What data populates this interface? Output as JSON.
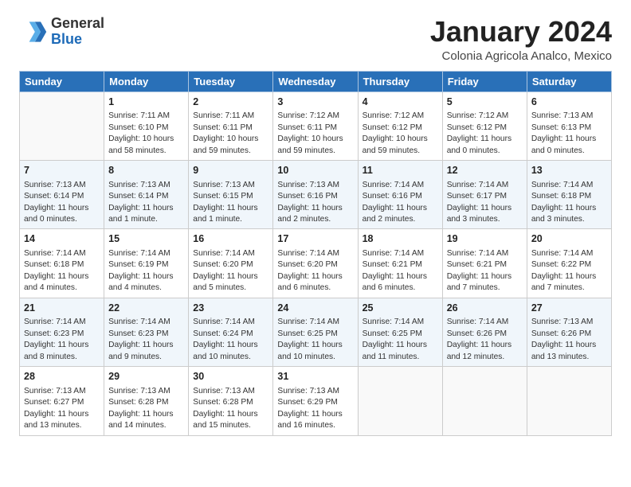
{
  "header": {
    "logo_general": "General",
    "logo_blue": "Blue",
    "month_title": "January 2024",
    "subtitle": "Colonia Agricola Analco, Mexico"
  },
  "weekdays": [
    "Sunday",
    "Monday",
    "Tuesday",
    "Wednesday",
    "Thursday",
    "Friday",
    "Saturday"
  ],
  "weeks": [
    [
      {
        "day": null,
        "info": null
      },
      {
        "day": "1",
        "info": "Sunrise: 7:11 AM\nSunset: 6:10 PM\nDaylight: 10 hours\nand 58 minutes."
      },
      {
        "day": "2",
        "info": "Sunrise: 7:11 AM\nSunset: 6:11 PM\nDaylight: 10 hours\nand 59 minutes."
      },
      {
        "day": "3",
        "info": "Sunrise: 7:12 AM\nSunset: 6:11 PM\nDaylight: 10 hours\nand 59 minutes."
      },
      {
        "day": "4",
        "info": "Sunrise: 7:12 AM\nSunset: 6:12 PM\nDaylight: 10 hours\nand 59 minutes."
      },
      {
        "day": "5",
        "info": "Sunrise: 7:12 AM\nSunset: 6:12 PM\nDaylight: 11 hours\nand 0 minutes."
      },
      {
        "day": "6",
        "info": "Sunrise: 7:13 AM\nSunset: 6:13 PM\nDaylight: 11 hours\nand 0 minutes."
      }
    ],
    [
      {
        "day": "7",
        "info": "Sunrise: 7:13 AM\nSunset: 6:14 PM\nDaylight: 11 hours\nand 0 minutes."
      },
      {
        "day": "8",
        "info": "Sunrise: 7:13 AM\nSunset: 6:14 PM\nDaylight: 11 hours\nand 1 minute."
      },
      {
        "day": "9",
        "info": "Sunrise: 7:13 AM\nSunset: 6:15 PM\nDaylight: 11 hours\nand 1 minute."
      },
      {
        "day": "10",
        "info": "Sunrise: 7:13 AM\nSunset: 6:16 PM\nDaylight: 11 hours\nand 2 minutes."
      },
      {
        "day": "11",
        "info": "Sunrise: 7:14 AM\nSunset: 6:16 PM\nDaylight: 11 hours\nand 2 minutes."
      },
      {
        "day": "12",
        "info": "Sunrise: 7:14 AM\nSunset: 6:17 PM\nDaylight: 11 hours\nand 3 minutes."
      },
      {
        "day": "13",
        "info": "Sunrise: 7:14 AM\nSunset: 6:18 PM\nDaylight: 11 hours\nand 3 minutes."
      }
    ],
    [
      {
        "day": "14",
        "info": "Sunrise: 7:14 AM\nSunset: 6:18 PM\nDaylight: 11 hours\nand 4 minutes."
      },
      {
        "day": "15",
        "info": "Sunrise: 7:14 AM\nSunset: 6:19 PM\nDaylight: 11 hours\nand 4 minutes."
      },
      {
        "day": "16",
        "info": "Sunrise: 7:14 AM\nSunset: 6:20 PM\nDaylight: 11 hours\nand 5 minutes."
      },
      {
        "day": "17",
        "info": "Sunrise: 7:14 AM\nSunset: 6:20 PM\nDaylight: 11 hours\nand 6 minutes."
      },
      {
        "day": "18",
        "info": "Sunrise: 7:14 AM\nSunset: 6:21 PM\nDaylight: 11 hours\nand 6 minutes."
      },
      {
        "day": "19",
        "info": "Sunrise: 7:14 AM\nSunset: 6:21 PM\nDaylight: 11 hours\nand 7 minutes."
      },
      {
        "day": "20",
        "info": "Sunrise: 7:14 AM\nSunset: 6:22 PM\nDaylight: 11 hours\nand 7 minutes."
      }
    ],
    [
      {
        "day": "21",
        "info": "Sunrise: 7:14 AM\nSunset: 6:23 PM\nDaylight: 11 hours\nand 8 minutes."
      },
      {
        "day": "22",
        "info": "Sunrise: 7:14 AM\nSunset: 6:23 PM\nDaylight: 11 hours\nand 9 minutes."
      },
      {
        "day": "23",
        "info": "Sunrise: 7:14 AM\nSunset: 6:24 PM\nDaylight: 11 hours\nand 10 minutes."
      },
      {
        "day": "24",
        "info": "Sunrise: 7:14 AM\nSunset: 6:25 PM\nDaylight: 11 hours\nand 10 minutes."
      },
      {
        "day": "25",
        "info": "Sunrise: 7:14 AM\nSunset: 6:25 PM\nDaylight: 11 hours\nand 11 minutes."
      },
      {
        "day": "26",
        "info": "Sunrise: 7:14 AM\nSunset: 6:26 PM\nDaylight: 11 hours\nand 12 minutes."
      },
      {
        "day": "27",
        "info": "Sunrise: 7:13 AM\nSunset: 6:26 PM\nDaylight: 11 hours\nand 13 minutes."
      }
    ],
    [
      {
        "day": "28",
        "info": "Sunrise: 7:13 AM\nSunset: 6:27 PM\nDaylight: 11 hours\nand 13 minutes."
      },
      {
        "day": "29",
        "info": "Sunrise: 7:13 AM\nSunset: 6:28 PM\nDaylight: 11 hours\nand 14 minutes."
      },
      {
        "day": "30",
        "info": "Sunrise: 7:13 AM\nSunset: 6:28 PM\nDaylight: 11 hours\nand 15 minutes."
      },
      {
        "day": "31",
        "info": "Sunrise: 7:13 AM\nSunset: 6:29 PM\nDaylight: 11 hours\nand 16 minutes."
      },
      {
        "day": null,
        "info": null
      },
      {
        "day": null,
        "info": null
      },
      {
        "day": null,
        "info": null
      }
    ]
  ]
}
